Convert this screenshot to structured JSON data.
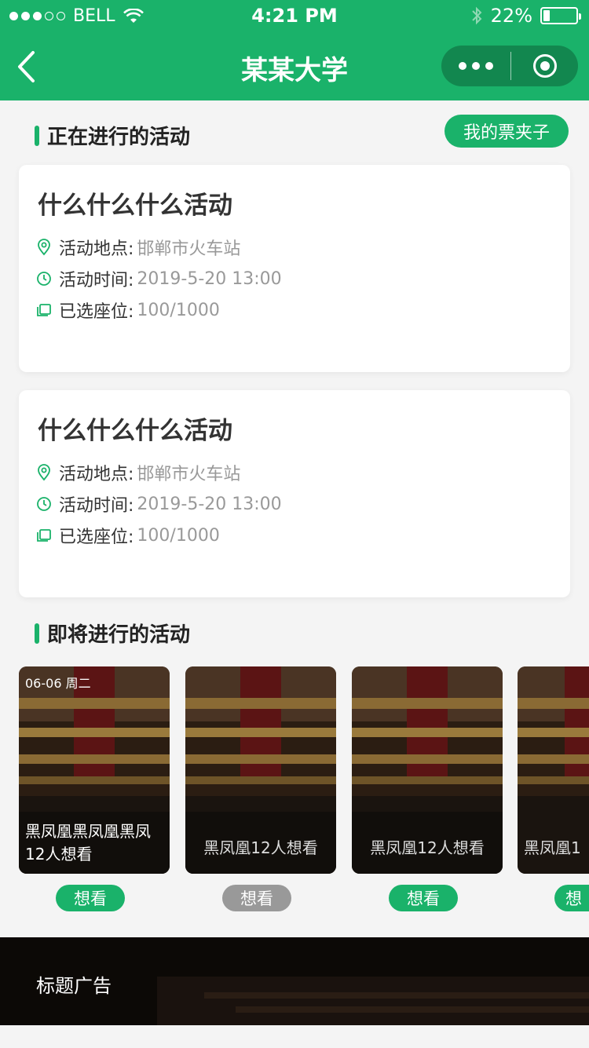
{
  "status_bar": {
    "carrier": "BELL",
    "time": "4:21 PM",
    "battery_percent": "22%"
  },
  "nav": {
    "title": "某某大学"
  },
  "ongoing": {
    "section_title": "正在进行的活动",
    "ticket_button": "我的票夹子",
    "cards": [
      {
        "title": "什么什么什么活动",
        "location_label": "活动地点:",
        "location": "邯郸市火车站",
        "time_label": "活动时间:",
        "time": "2019-5-20 13:00",
        "seats_label": "已选座位:",
        "seats": "100/1000"
      },
      {
        "title": "什么什么什么活动",
        "location_label": "活动地点:",
        "location": "邯郸市火车站",
        "time_label": "活动时间:",
        "time": "2019-5-20 13:00",
        "seats_label": "已选座位:",
        "seats": "100/1000"
      }
    ]
  },
  "upcoming": {
    "section_title": "即将进行的活动",
    "items": [
      {
        "date": "06-06 周二",
        "line1": "黑凤凰黑凤凰黑凤",
        "line2": "12人想看",
        "button": "想看",
        "button_state": "active"
      },
      {
        "caption": "黑凤凰12人想看",
        "button": "想看",
        "button_state": "inactive"
      },
      {
        "caption": "黑凤凰12人想看",
        "button": "想看",
        "button_state": "active"
      },
      {
        "caption": "黑凤凰1",
        "button": "想",
        "button_state": "active"
      }
    ]
  },
  "ad": {
    "title": "标题广告"
  },
  "colors": {
    "primary": "#1ab26a",
    "capsule": "#12874f",
    "inactive_button": "#999999"
  }
}
